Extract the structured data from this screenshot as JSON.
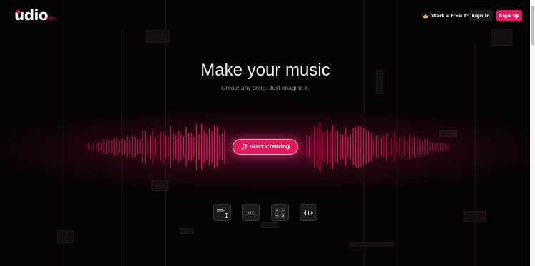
{
  "header": {
    "logo_text": "udio",
    "beta_label": "BETA",
    "trial_label": "Start a Free Trial",
    "signin_label": "Sign In",
    "signup_label": "Sign Up"
  },
  "hero": {
    "title": "Make your music",
    "subtitle": "Create any song. Just imagine it.",
    "cta_label": "Start Creating"
  },
  "features": [
    {
      "icon": "lyrics-editor-icon"
    },
    {
      "icon": "more-options-icon"
    },
    {
      "icon": "tools-grid-icon"
    },
    {
      "icon": "audio-waveform-icon"
    }
  ],
  "colors": {
    "accent": "#e3195d",
    "background": "#050305",
    "crown": "#f2b632"
  }
}
